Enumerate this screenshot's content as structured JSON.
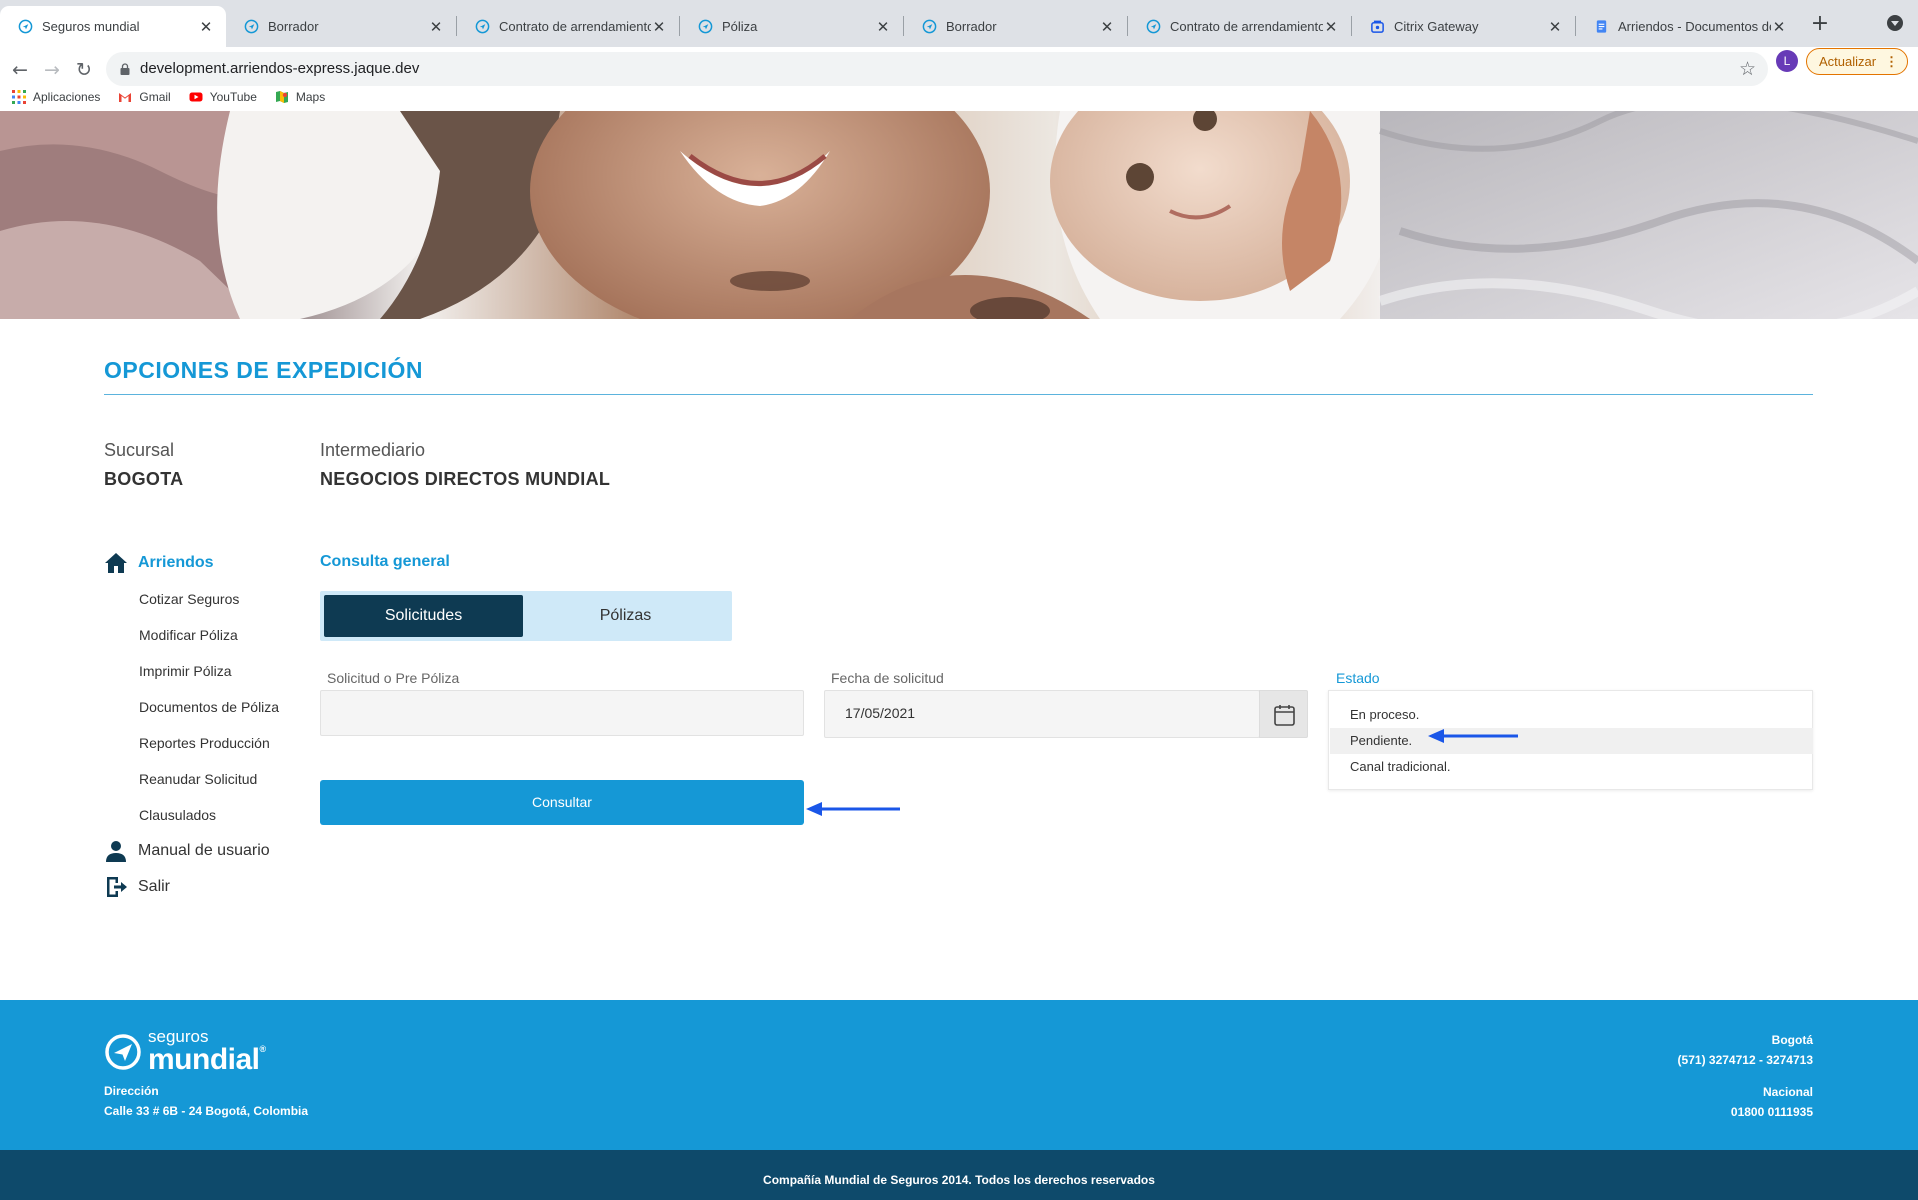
{
  "browser": {
    "tabs": [
      {
        "label": "Seguros mundial",
        "icon": "mundial-icon",
        "active": true
      },
      {
        "label": "Borrador",
        "icon": "mundial-icon"
      },
      {
        "label": "Contrato de arrendamiento",
        "icon": "mundial-icon"
      },
      {
        "label": "Póliza",
        "icon": "mundial-icon"
      },
      {
        "label": "Borrador",
        "icon": "mundial-icon"
      },
      {
        "label": "Contrato de arrendamiento",
        "icon": "mundial-icon"
      },
      {
        "label": "Citrix Gateway",
        "icon": "citrix-icon"
      },
      {
        "label": "Arriendos - Documentos de",
        "icon": "docs-icon"
      }
    ],
    "url": "development.arriendos-express.jaque.dev",
    "profile_initial": "L",
    "update_label": "Actualizar",
    "bookmarks": [
      {
        "label": "Aplicaciones",
        "icon": "apps-grid-icon"
      },
      {
        "label": "Gmail",
        "icon": "gmail-icon"
      },
      {
        "label": "YouTube",
        "icon": "youtube-icon"
      },
      {
        "label": "Maps",
        "icon": "maps-icon"
      }
    ]
  },
  "page": {
    "section_title": "OPCIONES DE EXPEDICIÓN",
    "sucursal_label": "Sucursal",
    "sucursal_value": "BOGOTA",
    "intermediario_label": "Intermediario",
    "intermediario_value": "NEGOCIOS DIRECTOS MUNDIAL",
    "sidebar": {
      "main": {
        "label": "Arriendos",
        "icon": "home-icon"
      },
      "items": [
        "Cotizar Seguros",
        "Modificar Póliza",
        "Imprimir Póliza",
        "Documentos de Póliza",
        "Reportes Producción",
        "Reanudar Solicitud",
        "Clausulados"
      ],
      "manual": {
        "label": "Manual de usuario",
        "icon": "user-icon"
      },
      "salir": {
        "label": "Salir",
        "icon": "logout-icon"
      }
    },
    "subtitle": "Consulta general",
    "tabs": {
      "active": "Solicitudes",
      "inactive": "Pólizas"
    },
    "form": {
      "solicitud_label": "Solicitud o Pre Póliza",
      "solicitud_value": "",
      "fecha_label": "Fecha de solicitud",
      "fecha_value": "17/05/2021",
      "estado_label": "Estado",
      "estado_options": [
        "En proceso.",
        "Pendiente.",
        "Canal tradicional."
      ],
      "estado_highlighted": "Pendiente.",
      "button_label": "Consultar"
    },
    "colors": {
      "accent": "#1598d6",
      "dark": "#0e3a52",
      "annotation_arrow": "#1a56e8"
    }
  },
  "footer": {
    "logo_top": "seguros",
    "logo_main": "mundial",
    "logo_reg": "®",
    "direccion_label": "Dirección",
    "direccion_value": "Calle 33 # 6B - 24 Bogotá, Colombia",
    "bogota_label": "Bogotá",
    "bogota_phone": "(571) 3274712 - 3274713",
    "nacional_label": "Nacional",
    "nacional_phone": "01800 0111935",
    "copyright": "Compañía Mundial de Seguros 2014. Todos los derechos reservados"
  }
}
